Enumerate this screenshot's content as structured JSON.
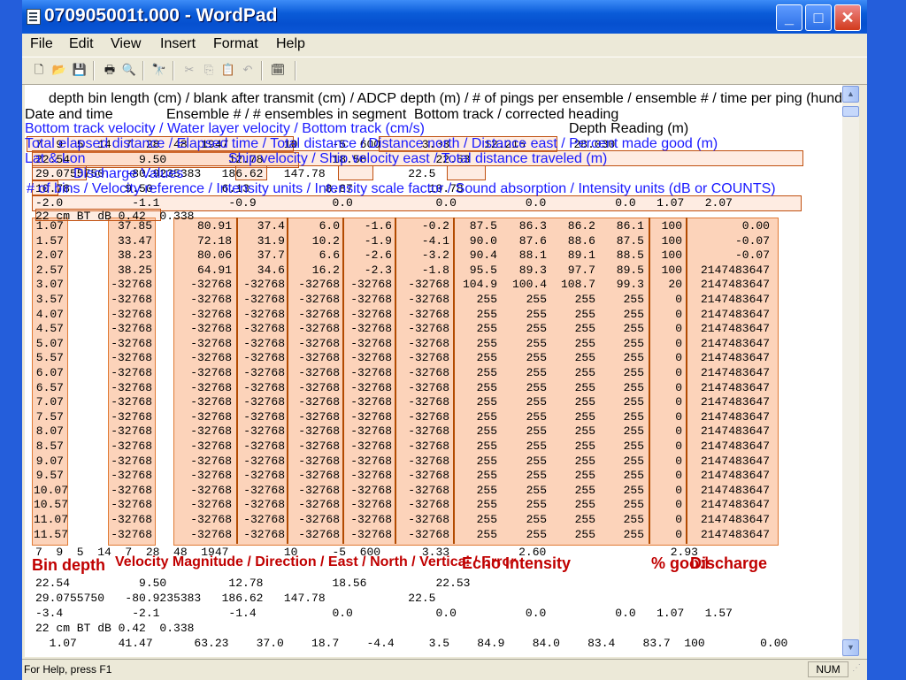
{
  "window": {
    "title": "070905001t.000 - WordPad",
    "buttons": {
      "minimize": "_",
      "maximize": "□",
      "close": "✕"
    }
  },
  "menu": [
    "File",
    "Edit",
    "View",
    "Insert",
    "Format",
    "Help"
  ],
  "status": {
    "help": "For Help, press F1",
    "num": "NUM"
  },
  "overlay": {
    "black_1": "depth bin length (cm) / blank after transmit (cm) / ADCP depth (m) / # of pings per ensemble / ensemble # / time per ping (hundredths of s)",
    "black_2a": "Date and time",
    "black_2b": "Ensemble # / # ensembles in segment",
    "black_2c": "Bottom track / corrected heading",
    "black_3": "Depth Reading (m)",
    "blue_1": "Bottom track velocity / Water layer velocity / Bottom track (cm/s)",
    "blue_2": "Total elapsed distance / Elapsed time / Total distance / Distance north / Distance east / Percent made good (m)",
    "blue_3a": "Lat & Lon",
    "blue_3b": "Ship velocity / Ship velocity east / Total distance traveled (m)",
    "blue_4": "Discharge Values",
    "blue_5": "# of bins / Velocity reference / Intensity units / Intensity scale factor / Sound absorption / Intensity units (dB or COUNTS)",
    "red": [
      "Bin depth",
      "Velocity Magnitude / Direction / East / North / Vertical / Error",
      "Echo Intensity",
      "% good",
      "Discharge"
    ]
  },
  "header_lines": [
    "7  9  5  14  7  28  48  1947        10     -5  600      3.33     12.216       28.030",
    "22.54          9.50         12.78          18.56          22.53",
    "29.0755750   -80.9235383   186.62   147.78            22.5",
    "10.78        9.50          6.13           8.87           10.78",
    "-2.0          -1.1          -0.9           0.0            0.0          0.0          0.0   1.07   2.07",
    "22 cm BT dB 0.42  0.338"
  ],
  "bin_table": [
    [
      "1.07",
      "37.85",
      "80.91",
      "37.4",
      "6.0",
      "-1.6",
      "-0.2",
      "87.5",
      "86.3",
      "86.2",
      "86.1",
      "100",
      "0.00"
    ],
    [
      "1.57",
      "33.47",
      "72.18",
      "31.9",
      "10.2",
      "-1.9",
      "-4.1",
      "90.0",
      "87.6",
      "88.6",
      "87.5",
      "100",
      "-0.07"
    ],
    [
      "2.07",
      "38.23",
      "80.06",
      "37.7",
      "6.6",
      "-2.6",
      "-3.2",
      "90.4",
      "88.1",
      "89.1",
      "88.5",
      "100",
      "-0.07"
    ],
    [
      "2.57",
      "38.25",
      "64.91",
      "34.6",
      "16.2",
      "-2.3",
      "-1.8",
      "95.5",
      "89.3",
      "97.7",
      "89.5",
      "100",
      "2147483647"
    ],
    [
      "3.07",
      "-32768",
      "-32768",
      "-32768",
      "-32768",
      "-32768",
      "-32768",
      "104.9",
      "100.4",
      "108.7",
      "99.3",
      "20",
      "2147483647"
    ],
    [
      "3.57",
      "-32768",
      "-32768",
      "-32768",
      "-32768",
      "-32768",
      "-32768",
      "255",
      "255",
      "255",
      "255",
      "0",
      "2147483647"
    ],
    [
      "4.07",
      "-32768",
      "-32768",
      "-32768",
      "-32768",
      "-32768",
      "-32768",
      "255",
      "255",
      "255",
      "255",
      "0",
      "2147483647"
    ],
    [
      "4.57",
      "-32768",
      "-32768",
      "-32768",
      "-32768",
      "-32768",
      "-32768",
      "255",
      "255",
      "255",
      "255",
      "0",
      "2147483647"
    ],
    [
      "5.07",
      "-32768",
      "-32768",
      "-32768",
      "-32768",
      "-32768",
      "-32768",
      "255",
      "255",
      "255",
      "255",
      "0",
      "2147483647"
    ],
    [
      "5.57",
      "-32768",
      "-32768",
      "-32768",
      "-32768",
      "-32768",
      "-32768",
      "255",
      "255",
      "255",
      "255",
      "0",
      "2147483647"
    ],
    [
      "6.07",
      "-32768",
      "-32768",
      "-32768",
      "-32768",
      "-32768",
      "-32768",
      "255",
      "255",
      "255",
      "255",
      "0",
      "2147483647"
    ],
    [
      "6.57",
      "-32768",
      "-32768",
      "-32768",
      "-32768",
      "-32768",
      "-32768",
      "255",
      "255",
      "255",
      "255",
      "0",
      "2147483647"
    ],
    [
      "7.07",
      "-32768",
      "-32768",
      "-32768",
      "-32768",
      "-32768",
      "-32768",
      "255",
      "255",
      "255",
      "255",
      "0",
      "2147483647"
    ],
    [
      "7.57",
      "-32768",
      "-32768",
      "-32768",
      "-32768",
      "-32768",
      "-32768",
      "255",
      "255",
      "255",
      "255",
      "0",
      "2147483647"
    ],
    [
      "8.07",
      "-32768",
      "-32768",
      "-32768",
      "-32768",
      "-32768",
      "-32768",
      "255",
      "255",
      "255",
      "255",
      "0",
      "2147483647"
    ],
    [
      "8.57",
      "-32768",
      "-32768",
      "-32768",
      "-32768",
      "-32768",
      "-32768",
      "255",
      "255",
      "255",
      "255",
      "0",
      "2147483647"
    ],
    [
      "9.07",
      "-32768",
      "-32768",
      "-32768",
      "-32768",
      "-32768",
      "-32768",
      "255",
      "255",
      "255",
      "255",
      "0",
      "2147483647"
    ],
    [
      "9.57",
      "-32768",
      "-32768",
      "-32768",
      "-32768",
      "-32768",
      "-32768",
      "255",
      "255",
      "255",
      "255",
      "0",
      "2147483647"
    ],
    [
      "10.07",
      "-32768",
      "-32768",
      "-32768",
      "-32768",
      "-32768",
      "-32768",
      "255",
      "255",
      "255",
      "255",
      "0",
      "2147483647"
    ],
    [
      "10.57",
      "-32768",
      "-32768",
      "-32768",
      "-32768",
      "-32768",
      "-32768",
      "255",
      "255",
      "255",
      "255",
      "0",
      "2147483647"
    ],
    [
      "11.07",
      "-32768",
      "-32768",
      "-32768",
      "-32768",
      "-32768",
      "-32768",
      "255",
      "255",
      "255",
      "255",
      "0",
      "2147483647"
    ],
    [
      "11.57",
      "-32768",
      "-32768",
      "-32768",
      "-32768",
      "-32768",
      "-32768",
      "255",
      "255",
      "255",
      "255",
      "0",
      "2147483647"
    ]
  ],
  "trailer_lines": [
    "7  9  5  14  7  28  48  1947        10     -5  600      3.33          2.60                  2.93",
    "22.54          9.50         12.78          18.56          22.53",
    "29.0755750   -80.9235383   186.62   147.78            22.5",
    "-3.4          -2.1          -1.4           0.0            0.0          0.0          0.0   1.07   1.57",
    "22 cm BT dB 0.42  0.338",
    "  1.07      41.47      63.23    37.0    18.7    -4.4     3.5    84.9    84.0    83.4    83.7  100        0.00"
  ],
  "colors": {
    "highlight": "#f8b08a",
    "overlay_blue": "#1a1aff",
    "overlay_red": "#c00000"
  }
}
